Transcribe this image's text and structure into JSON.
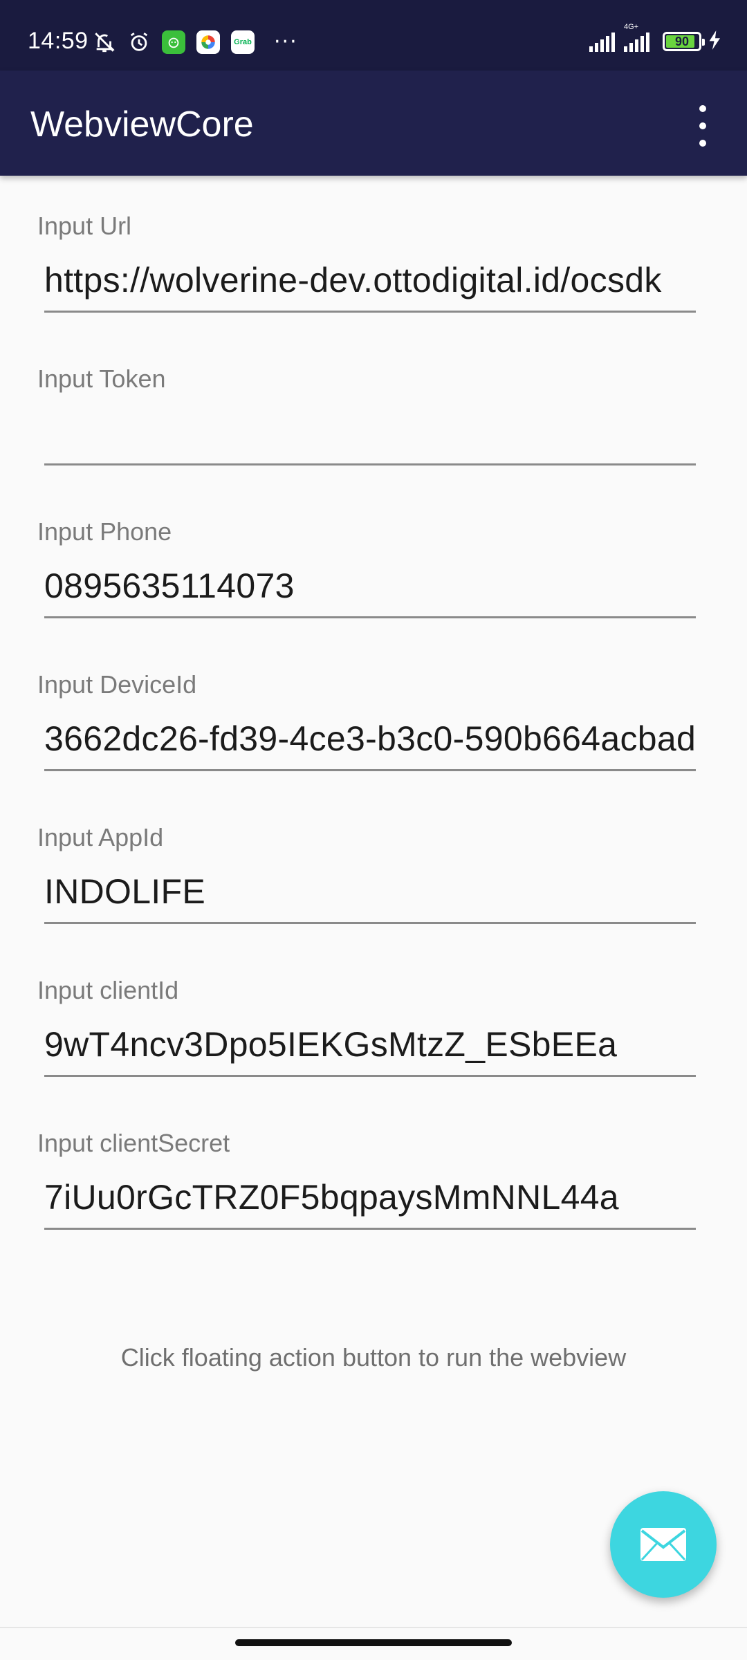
{
  "status_bar": {
    "time": "14:59",
    "network_label": "4G+",
    "battery_level": "90",
    "battery_fraction": 0.9,
    "left_icons": [
      "bell-off-icon",
      "alarm-icon",
      "app-icon-green",
      "app-icon-colorful",
      "grab-app-icon"
    ],
    "grab_badge_text": "Grab",
    "more_indicator": "···"
  },
  "app_bar": {
    "title": "WebviewCore",
    "menu_icon": "more-vert-icon"
  },
  "form": {
    "fields": [
      {
        "label": "Input Url",
        "value": "https://wolverine-dev.ottodigital.id/ocsdk"
      },
      {
        "label": "Input Token",
        "value": ""
      },
      {
        "label": "Input Phone",
        "value": "0895635114073"
      },
      {
        "label": "Input DeviceId",
        "value": "3662dc26-fd39-4ce3-b3c0-590b664acbad"
      },
      {
        "label": "Input AppId",
        "value": "INDOLIFE"
      },
      {
        "label": "Input clientId",
        "value": "9wT4ncv3Dpo5IEKGsMtzZ_ESbEEa"
      },
      {
        "label": "Input clientSecret",
        "value": "7iUu0rGcTRZ0F5bqpaysMmNNL44a"
      }
    ]
  },
  "hint": "Click floating action button to run the webview",
  "fab": {
    "icon": "email-icon",
    "color": "#3dd6e0"
  },
  "colors": {
    "status_bar_bg": "#1a1b3f",
    "app_bar_bg": "#20214c",
    "page_bg": "#fafafa",
    "accent": "#3dd6e0"
  }
}
